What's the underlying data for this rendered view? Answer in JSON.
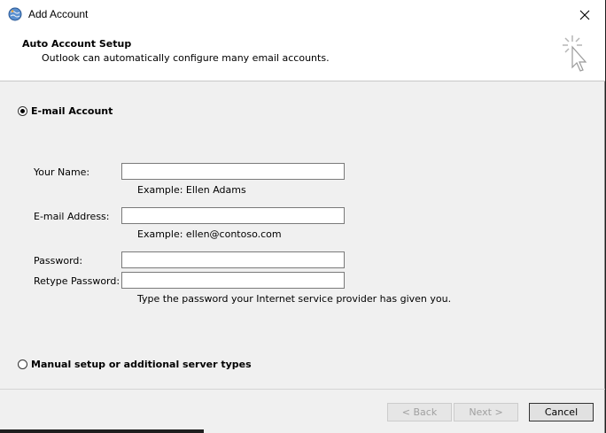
{
  "window": {
    "title": "Add Account",
    "app_icon": "outlook-globe-icon",
    "close_icon": "close-icon"
  },
  "header": {
    "title": "Auto Account Setup",
    "subtitle": "Outlook can automatically configure many email accounts.",
    "art_icon": "cursor-click-icon"
  },
  "options": {
    "email_account": {
      "label": "E-mail Account",
      "selected": true
    },
    "manual_setup": {
      "label": "Manual setup or additional server types",
      "selected": false
    }
  },
  "form": {
    "your_name": {
      "label": "Your Name:",
      "value": "",
      "hint": "Example: Ellen Adams"
    },
    "email_address": {
      "label": "E-mail Address:",
      "value": "",
      "hint": "Example: ellen@contoso.com"
    },
    "password": {
      "label": "Password:",
      "value": ""
    },
    "retype_password": {
      "label": "Retype Password:",
      "value": ""
    },
    "password_hint": "Type the password your Internet service provider has given you."
  },
  "buttons": {
    "back": {
      "label": "< Back",
      "enabled": false
    },
    "next": {
      "label": "Next >",
      "enabled": false
    },
    "cancel": {
      "label": "Cancel",
      "enabled": true
    }
  }
}
